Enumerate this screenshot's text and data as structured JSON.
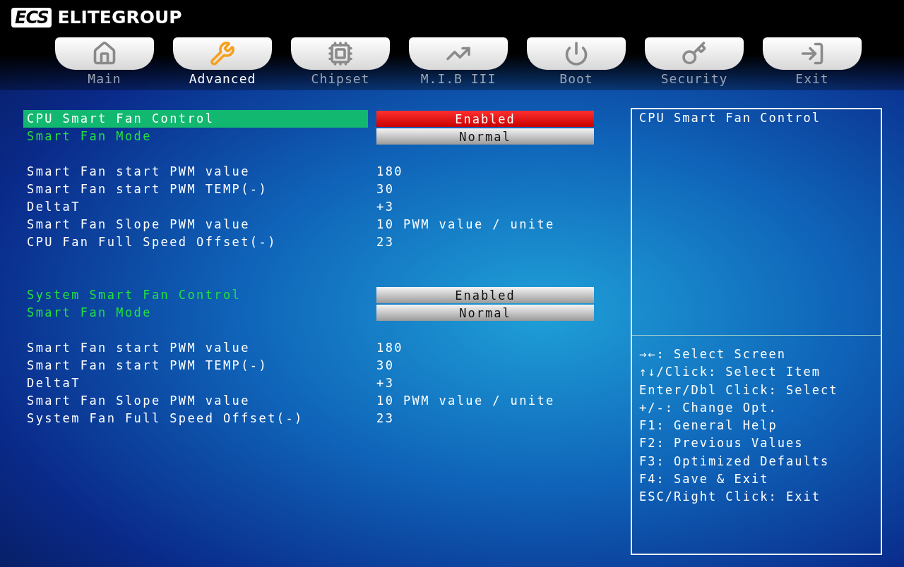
{
  "brand": {
    "logo": "ECS",
    "name": "ELITEGROUP"
  },
  "tabs": [
    {
      "label": "Main",
      "selected": false
    },
    {
      "label": "Advanced",
      "selected": true
    },
    {
      "label": "Chipset",
      "selected": false
    },
    {
      "label": "M.I.B III",
      "selected": false
    },
    {
      "label": "Boot",
      "selected": false
    },
    {
      "label": "Security",
      "selected": false
    },
    {
      "label": "Exit",
      "selected": false
    }
  ],
  "sections": [
    {
      "options": [
        {
          "label": "CPU Smart Fan Control",
          "value": "Enabled",
          "selected": true
        },
        {
          "label": "Smart Fan Mode",
          "value": "Normal",
          "selected": false
        }
      ],
      "values": [
        {
          "label": "Smart Fan start PWM value",
          "value": "180"
        },
        {
          "label": "Smart Fan start PWM TEMP(-)",
          "value": "30"
        },
        {
          "label": "DeltaT",
          "value": "+3"
        },
        {
          "label": "Smart Fan Slope PWM value",
          "value": "10 PWM value / unite"
        },
        {
          "label": "CPU Fan Full Speed Offset(-)",
          "value": "23"
        }
      ]
    },
    {
      "options": [
        {
          "label": "System Smart Fan Control",
          "value": "Enabled",
          "selected": false
        },
        {
          "label": "Smart Fan Mode",
          "value": "Normal",
          "selected": false
        }
      ],
      "values": [
        {
          "label": "Smart Fan start PWM value",
          "value": "180"
        },
        {
          "label": "Smart Fan start PWM TEMP(-)",
          "value": "30"
        },
        {
          "label": "DeltaT",
          "value": "+3"
        },
        {
          "label": "Smart Fan Slope PWM value",
          "value": "10 PWM value / unite"
        },
        {
          "label": "System Fan Full Speed Offset(-)",
          "value": "23"
        }
      ]
    }
  ],
  "help": {
    "title": "CPU Smart Fan Control",
    "keys": [
      "→←: Select Screen",
      "↑↓/Click: Select Item",
      "Enter/Dbl Click: Select",
      "+/-: Change Opt.",
      "F1: General Help",
      "F2: Previous Values",
      "F3: Optimized Defaults",
      "F4: Save & Exit",
      "ESC/Right Click: Exit"
    ]
  }
}
